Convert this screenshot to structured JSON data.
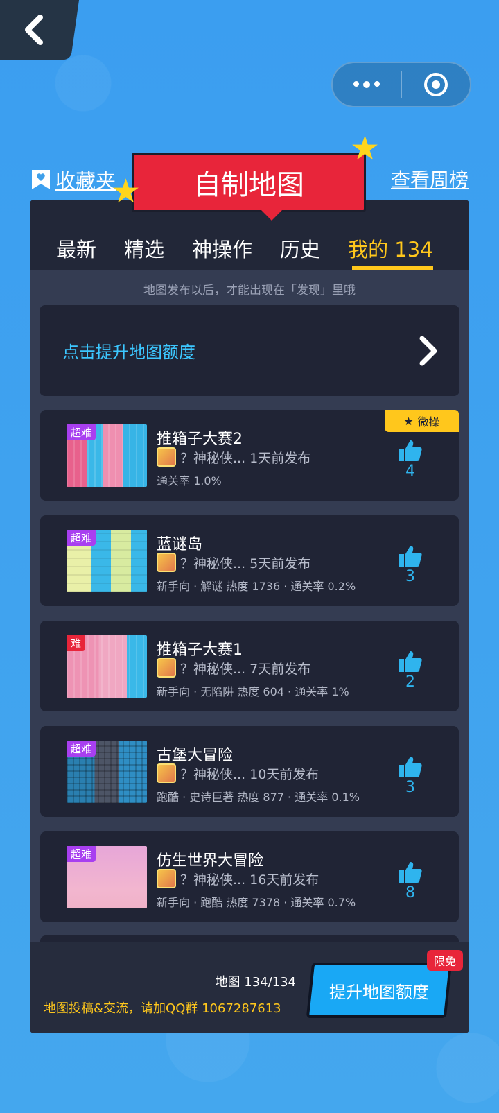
{
  "header": {
    "back_icon": "chevron-left-icon",
    "favorites_label": "收藏夹",
    "title": "自制地图",
    "weekly_label": "查看周榜"
  },
  "tabs": [
    {
      "label": "最新",
      "active": false
    },
    {
      "label": "精选",
      "active": false
    },
    {
      "label": "神操作",
      "active": false
    },
    {
      "label": "历史",
      "active": false
    },
    {
      "label": "我的 134",
      "active": true
    }
  ],
  "hint": "地图发布以后，才能出现在「发现」里哦",
  "boost_row": {
    "label": "点击提升地图额度"
  },
  "maps": [
    {
      "title": "推箱子大赛2",
      "difficulty": "超难",
      "difficulty_color": "#a83ff0",
      "author": "？神秘侠...",
      "published": "1天前发布",
      "meta": "通关率 1.0%",
      "likes": "4",
      "tag": "微操"
    },
    {
      "title": "蓝谜岛",
      "difficulty": "超难",
      "difficulty_color": "#a83ff0",
      "author": "？神秘侠...",
      "published": "5天前发布",
      "meta": "新手向 · 解谜 热度 1736 · 通关率 0.2%",
      "likes": "3"
    },
    {
      "title": "推箱子大赛1",
      "difficulty": "难",
      "difficulty_color": "#e8253a",
      "author": "？神秘侠...",
      "published": "7天前发布",
      "meta": "新手向 · 无陷阱 热度 604 · 通关率 1%",
      "likes": "2"
    },
    {
      "title": "古堡大冒险",
      "difficulty": "超难",
      "difficulty_color": "#a83ff0",
      "author": "？神秘侠...",
      "published": "10天前发布",
      "meta": "跑酷 · 史诗巨著 热度 877 · 通关率 0.1%",
      "likes": "3"
    },
    {
      "title": "仿生世界大冒险",
      "difficulty": "超难",
      "difficulty_color": "#a83ff0",
      "author": "？神秘侠...",
      "published": "16天前发布",
      "meta": "新手向 · 跑酷 热度 7378 · 通关率 0.7%",
      "likes": "8"
    }
  ],
  "footer": {
    "count": "地图 134/134",
    "qq_text": "地图投稿&交流，请加QQ群 1067287613",
    "boost_button": "提升地图额度",
    "free_badge": "限免"
  }
}
